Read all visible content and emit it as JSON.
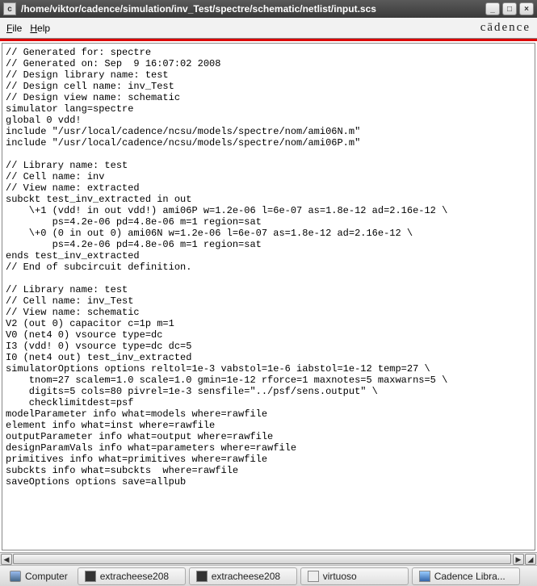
{
  "window": {
    "app_icon_char": "c",
    "title": "/home/viktor/cadence/simulation/inv_Test/spectre/schematic/netlist/input.scs",
    "minimize": "_",
    "maximize": "□",
    "close": "×"
  },
  "menubar": {
    "file": "File",
    "help": "Help",
    "brand": "cādence"
  },
  "scroll": {
    "left": "◀",
    "right": "▶",
    "grip": "◢"
  },
  "text_content": "// Generated for: spectre\n// Generated on: Sep  9 16:07:02 2008\n// Design library name: test\n// Design cell name: inv_Test\n// Design view name: schematic\nsimulator lang=spectre\nglobal 0 vdd!\ninclude \"/usr/local/cadence/ncsu/models/spectre/nom/ami06N.m\"\ninclude \"/usr/local/cadence/ncsu/models/spectre/nom/ami06P.m\"\n\n// Library name: test\n// Cell name: inv\n// View name: extracted\nsubckt test_inv_extracted in out\n    \\+1 (vdd! in out vdd!) ami06P w=1.2e-06 l=6e-07 as=1.8e-12 ad=2.16e-12 \\\n        ps=4.2e-06 pd=4.8e-06 m=1 region=sat\n    \\+0 (0 in out 0) ami06N w=1.2e-06 l=6e-07 as=1.8e-12 ad=2.16e-12 \\\n        ps=4.2e-06 pd=4.8e-06 m=1 region=sat\nends test_inv_extracted\n// End of subcircuit definition.\n\n// Library name: test\n// Cell name: inv_Test\n// View name: schematic\nV2 (out 0) capacitor c=1p m=1\nV0 (net4 0) vsource type=dc\nI3 (vdd! 0) vsource type=dc dc=5\nI0 (net4 out) test_inv_extracted\nsimulatorOptions options reltol=1e-3 vabstol=1e-6 iabstol=1e-12 temp=27 \\\n    tnom=27 scalem=1.0 scale=1.0 gmin=1e-12 rforce=1 maxnotes=5 maxwarns=5 \\\n    digits=5 cols=80 pivrel=1e-3 sensfile=\"../psf/sens.output\" \\\n    checklimitdest=psf\nmodelParameter info what=models where=rawfile\nelement info what=inst where=rawfile\noutputParameter info what=output where=rawfile\ndesignParamVals info what=parameters where=rawfile\nprimitives info what=primitives where=rawfile\nsubckts info what=subckts  where=rawfile\nsaveOptions options save=allpub",
  "taskbar": {
    "computer": "Computer",
    "extracheese1": "extracheese208",
    "extracheese2": "extracheese208",
    "virtuoso": "virtuoso",
    "cadence_lib": "Cadence Libra..."
  }
}
